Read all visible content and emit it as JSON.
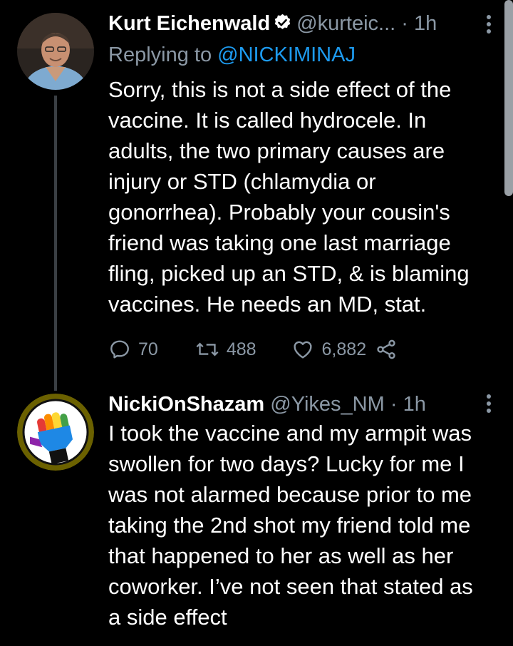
{
  "tweet1": {
    "display_name": "Kurt Eichenwald",
    "handle": "@kurteic...",
    "separator": "·",
    "time": "1h",
    "reply_prefix": "Replying to",
    "reply_to": "@NICKIMINAJ",
    "lines": [
      "Sorry, this is not a side effect of the",
      "vaccine. It is called hydrocele. In",
      "adults, the two primary causes are",
      "injury or STD (chlamydia or",
      "gonorrhea). Probably your cousin's",
      "friend was taking one last marriage",
      "fling, picked up an STD, & is blaming",
      "vaccines. He needs an MD, stat."
    ],
    "replies": "70",
    "retweets": "488",
    "likes": "6,882"
  },
  "tweet2": {
    "display_name": "NickiOnShazam",
    "handle": "@Yikes_NM",
    "separator": "·",
    "time": "1h",
    "lines": [
      "I took the vaccine and my armpit was",
      "swollen for two days? Lucky for me I",
      "was not alarmed because prior to me",
      "taking the 2nd shot my friend told me",
      "that happened to her as well as her",
      "coworker. I’ve not seen that stated as",
      "a side effect"
    ]
  },
  "icons": {
    "verified": "verified-badge-icon",
    "reply": "reply-icon",
    "retweet": "retweet-icon",
    "like": "heart-icon",
    "share": "share-icon",
    "more": "more-vertical-icon"
  },
  "colors": {
    "background": "#000000",
    "accent": "#1d9bf0",
    "muted": "#8b98a5"
  }
}
